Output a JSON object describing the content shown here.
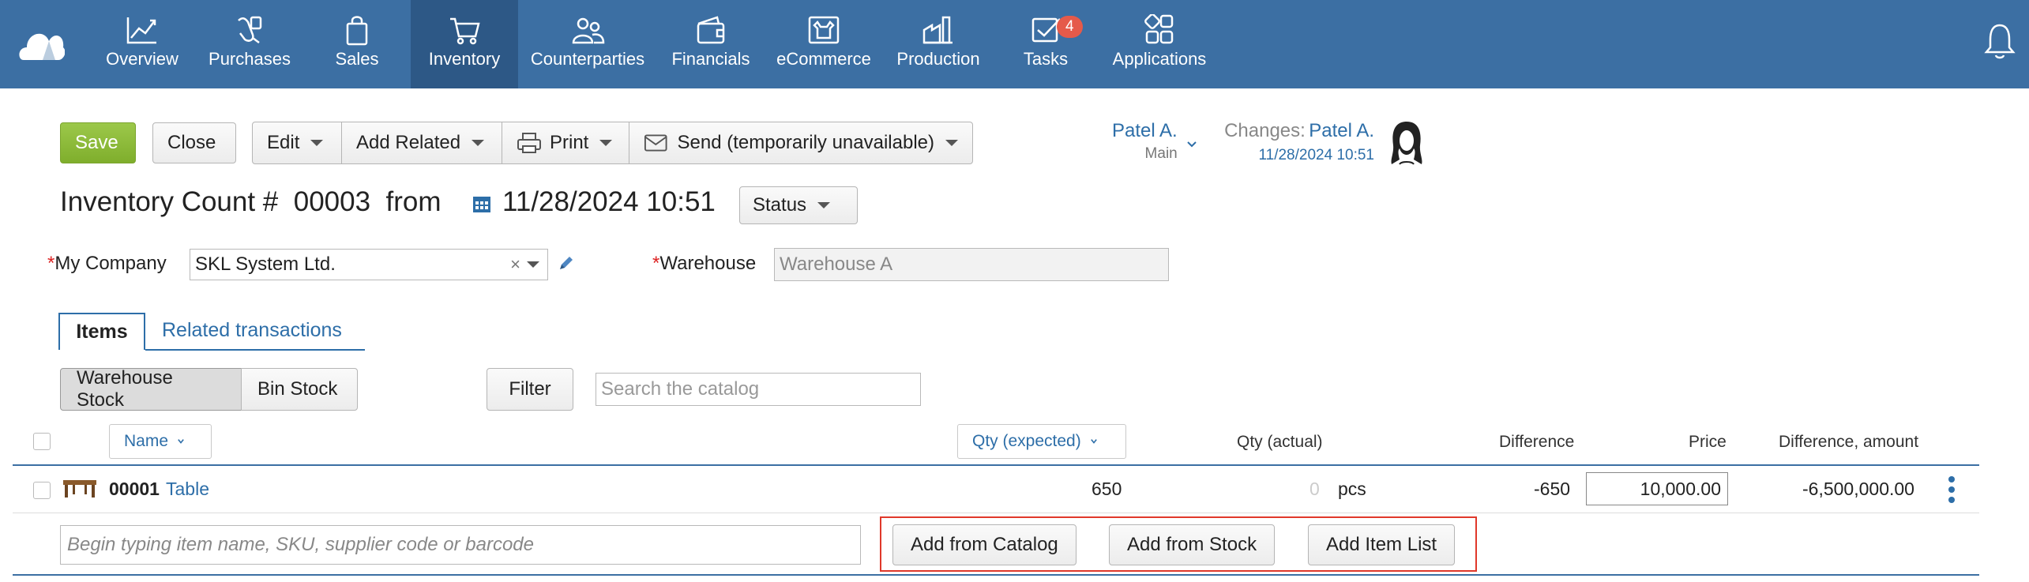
{
  "nav": {
    "items": [
      {
        "label": "Overview",
        "icon": "chart-line-icon"
      },
      {
        "label": "Purchases",
        "icon": "hand-bag-icon"
      },
      {
        "label": "Sales",
        "icon": "shopping-bag-icon"
      },
      {
        "label": "Inventory",
        "icon": "cart-icon",
        "active": true
      },
      {
        "label": "Counterparties",
        "icon": "people-icon"
      },
      {
        "label": "Financials",
        "icon": "wallet-icon"
      },
      {
        "label": "eCommerce",
        "icon": "storefront-icon"
      },
      {
        "label": "Production",
        "icon": "factory-icon"
      },
      {
        "label": "Tasks",
        "icon": "tasks-check-icon",
        "badge": "4"
      },
      {
        "label": "Applications",
        "icon": "apps-grid-icon"
      }
    ],
    "brand_color": "#3c6fa3",
    "badge_color": "#e55a4a"
  },
  "toolbar": {
    "save": "Save",
    "close": "Close",
    "edit": "Edit",
    "add_related": "Add Related",
    "print": "Print",
    "send": "Send (temporarily unavailable)"
  },
  "owner": {
    "name": "Patel A.",
    "role": "Main"
  },
  "changes": {
    "label": "Changes:",
    "name": "Patel A.",
    "time": "11/28/2024 10:51"
  },
  "document": {
    "title": "Inventory Count #",
    "number": "00003",
    "from": "from",
    "datetime": "11/28/2024 10:51",
    "status": "Status"
  },
  "form": {
    "company_label": "My Company",
    "company_value": "SKL System Ltd.",
    "warehouse_label": "Warehouse",
    "warehouse_placeholder": "Warehouse A",
    "required_mark": "*"
  },
  "tabs": {
    "items": "Items",
    "related": "Related transactions"
  },
  "view": {
    "warehouse_stock": "Warehouse Stock",
    "bin_stock": "Bin Stock",
    "filter": "Filter",
    "search_placeholder": "Search the catalog"
  },
  "table": {
    "headers": {
      "name": "Name",
      "qty_expected": "Qty (expected)",
      "qty_actual": "Qty (actual)",
      "difference": "Difference",
      "price": "Price",
      "difference_amount": "Difference, amount"
    },
    "rows": [
      {
        "sku": "00001",
        "name": "Table",
        "qty_expected": "650",
        "qty_actual": "0",
        "unit": "pcs",
        "difference": "-650",
        "price": "10,000.00",
        "difference_amount": "-6,500,000.00"
      }
    ]
  },
  "add_row": {
    "placeholder": "Begin typing item name, SKU, supplier code or barcode",
    "add_from_catalog": "Add from Catalog",
    "add_from_stock": "Add from Stock",
    "add_item_list": "Add Item List"
  }
}
